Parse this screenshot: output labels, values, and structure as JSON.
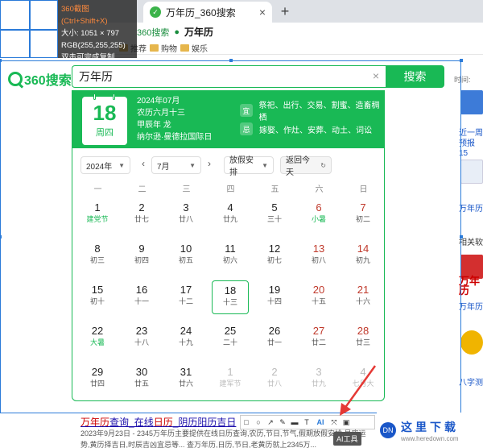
{
  "browser": {
    "tab_title": "万年历_360搜索",
    "tab_close": "×",
    "new_tab": "+",
    "addr_provider": "360搜索",
    "addr_text": "万年历",
    "bookmarks": [
      "推荐",
      "购物",
      "娱乐"
    ]
  },
  "capture": {
    "title": "360截图(Ctrl+Shift+X)",
    "size": "大小: 1051 × 797",
    "rgb": "RGB(255,255,255)",
    "hint": "双击可完成复制"
  },
  "search": {
    "logo": "360搜索",
    "query": "万年历",
    "clear": "×",
    "button": "搜索",
    "time_label": "时间:"
  },
  "calendar": {
    "big_day": "18",
    "weekday": "周四",
    "year_month": "2024年07月",
    "lunar": "农历六月十三",
    "ganzhi": "甲辰年 龙",
    "festival": "纳尔逊·曼德拉国际日",
    "yi_label": "宜",
    "yi_items": "祭祀、出行、交易、割蜜、造畜稠栖",
    "ji_label": "忌",
    "ji_items": "嫁娶、作灶、安葬、动土、词讼",
    "year_select": "2024年",
    "month_select": "7月",
    "holiday_select": "放假安排",
    "back_today": "返回今天",
    "prev": "‹",
    "next": "›",
    "weekdays": [
      "一",
      "二",
      "三",
      "四",
      "五",
      "六",
      "日"
    ],
    "weeks": [
      [
        {
          "n": "1",
          "l": "建党节",
          "f": true
        },
        {
          "n": "2",
          "l": "廿七"
        },
        {
          "n": "3",
          "l": "廿八"
        },
        {
          "n": "4",
          "l": "廿九"
        },
        {
          "n": "5",
          "l": "三十"
        },
        {
          "n": "6",
          "l": "小暑",
          "f": true
        },
        {
          "n": "7",
          "l": "初二"
        }
      ],
      [
        {
          "n": "8",
          "l": "初三"
        },
        {
          "n": "9",
          "l": "初四"
        },
        {
          "n": "10",
          "l": "初五"
        },
        {
          "n": "11",
          "l": "初六"
        },
        {
          "n": "12",
          "l": "初七"
        },
        {
          "n": "13",
          "l": "初八"
        },
        {
          "n": "14",
          "l": "初九"
        }
      ],
      [
        {
          "n": "15",
          "l": "初十"
        },
        {
          "n": "16",
          "l": "十一"
        },
        {
          "n": "17",
          "l": "十二"
        },
        {
          "n": "18",
          "l": "十三",
          "today": true
        },
        {
          "n": "19",
          "l": "十四"
        },
        {
          "n": "20",
          "l": "十五"
        },
        {
          "n": "21",
          "l": "十六"
        }
      ],
      [
        {
          "n": "22",
          "l": "大暑",
          "f": true
        },
        {
          "n": "23",
          "l": "十八"
        },
        {
          "n": "24",
          "l": "十九"
        },
        {
          "n": "25",
          "l": "二十"
        },
        {
          "n": "26",
          "l": "廿一"
        },
        {
          "n": "27",
          "l": "廿二"
        },
        {
          "n": "28",
          "l": "廿三"
        }
      ],
      [
        {
          "n": "29",
          "l": "廿四"
        },
        {
          "n": "30",
          "l": "廿五"
        },
        {
          "n": "31",
          "l": "廿六"
        },
        {
          "n": "1",
          "l": "建军节",
          "other": true
        },
        {
          "n": "2",
          "l": "廿八",
          "other": true
        },
        {
          "n": "3",
          "l": "廿九",
          "other": true
        },
        {
          "n": "4",
          "l": "七月大",
          "other": true
        }
      ]
    ]
  },
  "right_strip": {
    "items": [
      "近一周",
      "预报15",
      "万年历",
      "相关软",
      "万年历",
      "万年历",
      "万年历",
      "八字测"
    ]
  },
  "result": {
    "title_a": "万年历",
    "title_b": "查询_在线",
    "title_c": "日历",
    "title_d": "_阴历阳历吉日",
    "desc": "2023年9月23日 - 2345万年历主要提供在线日历查询,农历,节日,节气,假期放假安排,星座运",
    "desc2": "势,黄历择吉日,时辰吉凶宜忌等... 查万年历,日历,节日,老黄历就上2345万..."
  },
  "toolbar": {
    "tools": [
      "□",
      "○",
      "↗",
      "✎",
      "▬",
      "T",
      "AI",
      "⤧",
      "▣"
    ],
    "tooltip": "AI工具"
  },
  "watermark": {
    "logo": "DN",
    "cn": "这里下载",
    "url": "www.heredown.com"
  }
}
